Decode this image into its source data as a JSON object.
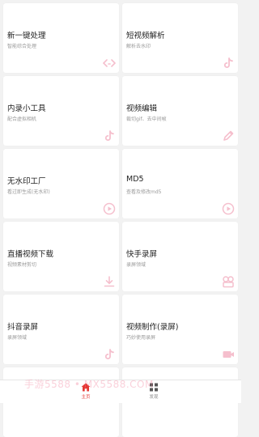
{
  "cards": [
    {
      "title": "新一键处理",
      "subtitle": "智能综合处理",
      "icon": "code-icon"
    },
    {
      "title": "短视频解析",
      "subtitle": "解析去水印",
      "icon": "tiktok-icon"
    },
    {
      "title": "内录小工具",
      "subtitle": "配合虚拟相机",
      "icon": "tiktok-icon"
    },
    {
      "title": "视频编辑",
      "subtitle": "裁切gif、去中间帧",
      "icon": "pencil-icon"
    },
    {
      "title": "无水印工厂",
      "subtitle": "看过即生成(无水印)",
      "icon": "play-circle-icon"
    },
    {
      "title": "MD5",
      "subtitle": "查看及修改md5",
      "icon": "play-circle-icon"
    },
    {
      "title": "直播视频下载",
      "subtitle": "视频素材剪切",
      "icon": "download-icon"
    },
    {
      "title": "快手录屏",
      "subtitle": "录屏领域",
      "icon": "film-reel-icon"
    },
    {
      "title": "抖音录屏",
      "subtitle": "录屏领域",
      "icon": "tiktok-icon"
    },
    {
      "title": "视频制作(录屏)",
      "subtitle": "巧妙使用录屏",
      "icon": "video-icon"
    }
  ],
  "watermark": "手游5588 • MX5588.COM",
  "tabbar": {
    "home_label": "主页",
    "discover_label": "发现"
  },
  "colors": {
    "icon_pink": "#f4b9c8",
    "active_red": "#e53935",
    "background": "#f2f2f2"
  }
}
